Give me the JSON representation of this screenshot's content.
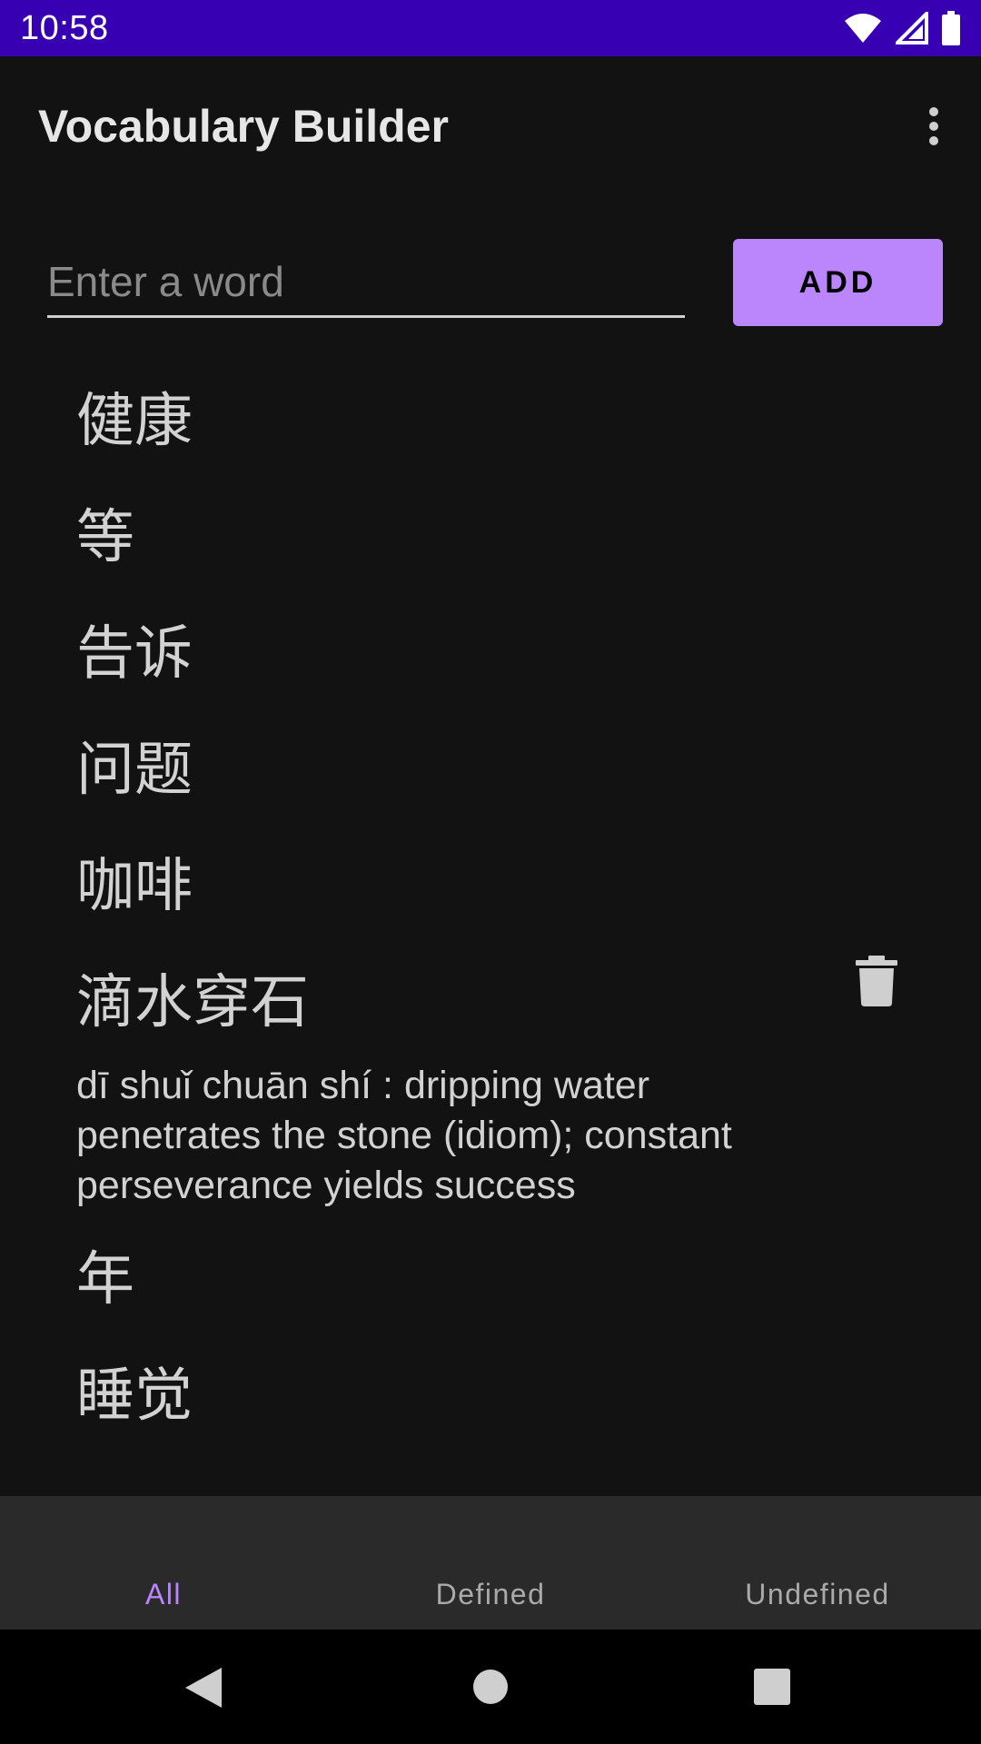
{
  "status_bar": {
    "time": "10:58"
  },
  "app_bar": {
    "title": "Vocabulary Builder"
  },
  "input": {
    "placeholder": "Enter a word",
    "value": ""
  },
  "add_button": {
    "label": "ADD"
  },
  "words": [
    {
      "word": "健康"
    },
    {
      "word": "等"
    },
    {
      "word": "告诉"
    },
    {
      "word": "问题"
    },
    {
      "word": "咖啡"
    },
    {
      "word": "滴水穿石",
      "definition": "dī shuǐ chuān shí : dripping water penetrates the stone (idiom); constant perseverance yields success"
    },
    {
      "word": "年"
    },
    {
      "word": "睡觉"
    }
  ],
  "tabs": [
    {
      "label": "All",
      "active": true
    },
    {
      "label": "Defined",
      "active": false
    },
    {
      "label": "Undefined",
      "active": false
    }
  ],
  "colors": {
    "status_bar": "#3700B3",
    "accent": "#BB86FC",
    "background": "#121212"
  },
  "icons": [
    "wifi-icon",
    "signal-icon",
    "battery-icon",
    "more-vert-icon",
    "delete-icon",
    "back-icon",
    "home-icon",
    "recents-icon"
  ]
}
